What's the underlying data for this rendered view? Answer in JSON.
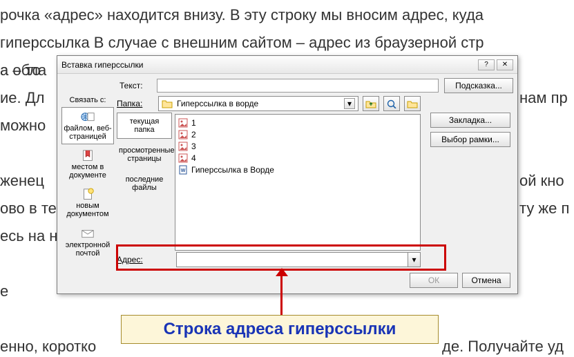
{
  "background": {
    "line1": "рочка «адрес» находится внизу. В эту строку мы вносим адрес, куда",
    "line2": "гиперссылка   В случае с внешним сайтом – адрес из браузерной стр",
    "line3a": "а обла",
    "line3b": "а – то",
    "line4a": "ие. Дл",
    "line4b": "нам пр",
    "line5a": "можно",
    "line6a": "женец",
    "line6b": "ой кно",
    "line7a": "ово в те",
    "line7b": "ту же п",
    "line8a": "есь на н",
    "line9a": "е",
    "line10a": "енно, коротко",
    "line10b": "де. Получайте уд"
  },
  "dialog": {
    "title": "Вставка гиперссылки",
    "linkGroup": "Связать с:",
    "textLabel": "Текст:",
    "textValue": "",
    "hintBtn": "Подсказка...",
    "tabs": {
      "fileWeb": "файлом, веб-страницей",
      "place": "местом в документе",
      "newDoc": "новым документом",
      "email": "электронной почтой"
    },
    "mid": {
      "current": "текущая папка",
      "browsed": "просмотренные страницы",
      "recent": "последние файлы"
    },
    "folderLabel": "Папка:",
    "folderName": "Гиперссылка в ворде",
    "files": [
      "1",
      "2",
      "3",
      "4",
      "Гиперссылка в Ворде"
    ],
    "bookmarkBtn": "Закладка...",
    "frameBtn": "Выбор рамки...",
    "addrLabel": "Адрес:",
    "addrValue": "",
    "ok": "ОК",
    "cancel": "Отмена"
  },
  "callout": "Строка адреса гиперссылки"
}
